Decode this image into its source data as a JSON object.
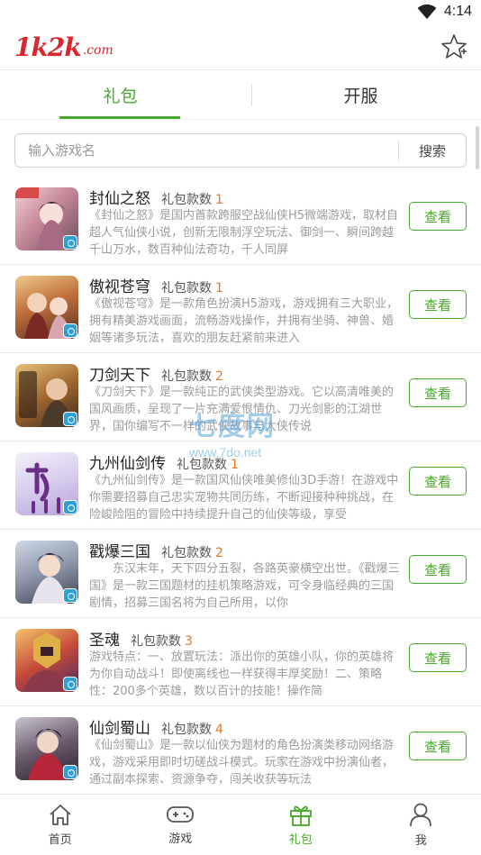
{
  "status_bar": {
    "time": "4:14"
  },
  "header": {
    "logo_main": "1k2k",
    "logo_suffix": ".com"
  },
  "tabs": [
    {
      "label": "礼包",
      "active": true
    },
    {
      "label": "开服",
      "active": false
    }
  ],
  "search": {
    "placeholder": "输入游戏名",
    "button_label": "搜索"
  },
  "count_label": "礼包款数",
  "view_label": "查看",
  "games": [
    {
      "title": "封仙之怒",
      "count": "1",
      "desc": "《封仙之怒》是国内首款跨服空战仙侠H5微端游戏，取材自超人气仙侠小说，创新无限制浮空玩法、御剑一、瞬间跨越千山万水，数百种仙法奇功，千人同屏"
    },
    {
      "title": "傲视苍穹",
      "count": "1",
      "desc": "《傲视苍穹》是一款角色扮演H5游戏，游戏拥有三大职业，拥有精美游戏画面，流畅游戏操作，并拥有坐骑、神兽、婚姻等诸多玩法，喜欢的朋友赶紧前来进入"
    },
    {
      "title": "刀剑天下",
      "count": "2",
      "desc": "《刀剑天下》是一款纯正的武侠类型游戏。它以高清唯美的国风画质，呈现了一片充满爱恨情仇、刀光剑影的江湖世界，国你编写不一样的武侠故事与大侠传说"
    },
    {
      "title": "九州仙剑传",
      "count": "1",
      "desc": "《九州仙剑传》是一款国风仙侠唯美修仙3D手游！在游戏中你需要招募自己忠实宠物共同历练，不断迎接种种挑战，在险峻险阻的冒险中持续提升自己的仙侠等级，享受"
    },
    {
      "title": "戳爆三国",
      "count": "2",
      "desc": "　　东汉末年，天下四分五裂，各路英豪横空出世。《戳爆三国》是一款三国题材的挂机策略游戏，可令身临经典的三国剧情，招募三国名将为自己所用，以你"
    },
    {
      "title": "圣魂",
      "count": "3",
      "desc": "游戏特点：一、放置玩法：派出你的英雄小队，你的英雄将为你自动战斗！即使离线也一样获得丰厚奖励！二、策略性：200多个英雄，数以百计的技能！操作简"
    },
    {
      "title": "仙剑蜀山",
      "count": "4",
      "desc": "《仙剑蜀山》是一款以仙侠为题材的角色扮演类移动网络游戏，游戏采用即时切磋战斗模式。玩家在游戏中扮演仙者，通过副本探索、资源争夺，闯关收获等玩法"
    }
  ],
  "watermark": {
    "cn": "七度网",
    "url": "www.7do.net"
  },
  "bottom_nav": [
    {
      "label": "首页",
      "icon": "home-icon",
      "active": false
    },
    {
      "label": "游戏",
      "icon": "gamepad-icon",
      "active": false
    },
    {
      "label": "礼包",
      "icon": "gift-icon",
      "active": true
    },
    {
      "label": "我",
      "icon": "user-icon",
      "active": false
    }
  ],
  "colors": {
    "accent": "#4aa82d",
    "count": "#e8742a",
    "logo": "#d9272e"
  }
}
